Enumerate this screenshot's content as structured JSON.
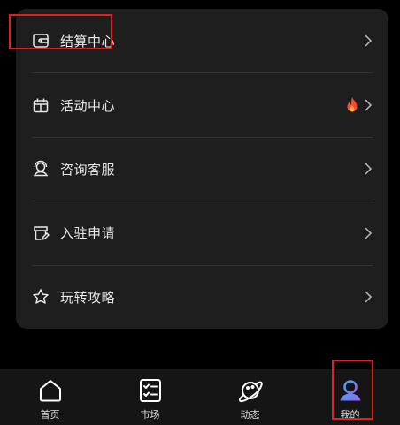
{
  "menu": {
    "items": [
      {
        "label": "结算中心",
        "icon": "wallet-icon"
      },
      {
        "label": "活动中心",
        "icon": "gift-calendar-icon",
        "badge_icon": "fire-icon"
      },
      {
        "label": "咨询客服",
        "icon": "customer-service-icon"
      },
      {
        "label": "入驻申请",
        "icon": "application-icon"
      },
      {
        "label": "玩转攻略",
        "icon": "star-icon"
      }
    ],
    "chevron_icon": "chevron-right-icon"
  },
  "tabbar": {
    "items": [
      {
        "label": "首页",
        "icon": "home-icon"
      },
      {
        "label": "市场",
        "icon": "market-checklist-icon"
      },
      {
        "label": "动态",
        "icon": "planet-icon"
      },
      {
        "label": "我的",
        "icon": "profile-icon",
        "active": true
      }
    ]
  },
  "colors": {
    "background": "#000000",
    "card": "#1e1e1e",
    "divider": "#333333",
    "text": "#e8e8e8",
    "highlight": "#e02020",
    "fire": "#ff4a2a",
    "active_tab_gradient": [
      "#3fa9f5",
      "#a25cf0"
    ]
  }
}
